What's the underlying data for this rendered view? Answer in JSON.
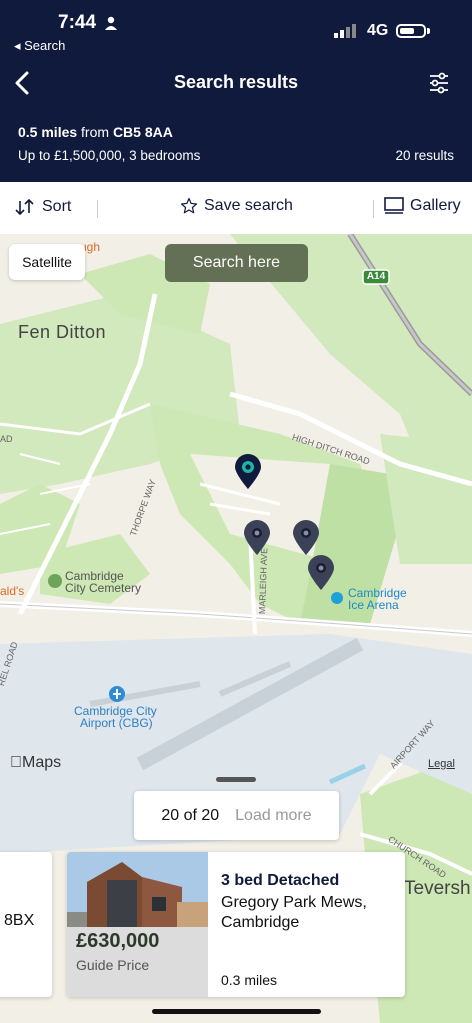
{
  "status_bar": {
    "time": "7:44",
    "back_label": "◂ Search",
    "network": "4G"
  },
  "header": {
    "title": "Search results",
    "distance": "0.5 miles",
    "from_text": "from",
    "postcode": "CB5 8AA",
    "criteria": "Up to £1,500,000, 3 bedrooms",
    "results": "20 results"
  },
  "toolbar": {
    "sort": "Sort",
    "save_search": "Save search",
    "gallery": "Gallery"
  },
  "map": {
    "satellite": "Satellite",
    "search_here": "Search here",
    "places": {
      "fen_ditton": "Fen Ditton",
      "high_ditch_road": "HIGH DITCH ROAD",
      "thorpe_way": "THORPE WAY",
      "marleigh_ave": "MARLEIGH AVE",
      "cemetery1": "Cambridge",
      "cemetery2": "City Cemetery",
      "ice1": "Cambridge",
      "ice2": "Ice Arena",
      "airport1": "Cambridge City",
      "airport2": "Airport (CBG)",
      "airport_way": "AIRPORT WAY",
      "church_road": "CHURCH ROAD",
      "teversham": "Teversh",
      "a14": "A14",
      "frag_ugh": "ugh",
      "frag_alds": "ald's",
      "frag_ad": "AD",
      "frag_rel": "REL ROAD"
    },
    "apple_maps": "Maps",
    "legal": "Legal"
  },
  "pagination": {
    "count": "20 of 20",
    "load_more": "Load more"
  },
  "cards": {
    "prev_fragment": "8BX",
    "current": {
      "price": "£630,000",
      "price_note": "Guide Price",
      "title": "3 bed Detached",
      "address1": "Gregory Park Mews,",
      "address2": "Cambridge",
      "distance": "0.3 miles"
    }
  },
  "colors": {
    "navy": "#0f1a3d",
    "pin_selected": "#1fb5a3",
    "park": "#cde7b5"
  }
}
